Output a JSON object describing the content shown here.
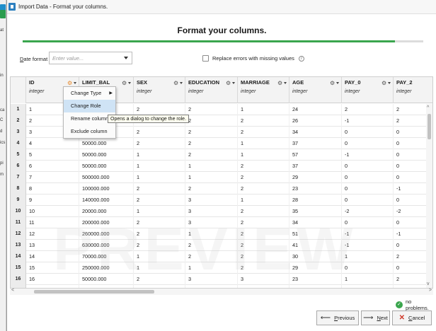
{
  "window": {
    "title": "Import Data - Format your columns."
  },
  "background_app": {
    "sidebar_fragments": [
      "at",
      "in",
      "ca",
      "C",
      "d",
      "ics",
      "pi",
      "m"
    ]
  },
  "page": {
    "heading": "Format your columns.",
    "progress_percent": 93
  },
  "date_format": {
    "label_prefix": "D",
    "label_rest": "ate format",
    "placeholder": "Enter value..."
  },
  "replace_errors": {
    "label": "Replace errors with missing values",
    "checked": false,
    "info_icon": "info-icon"
  },
  "columns": [
    {
      "name": "ID",
      "type": "integer"
    },
    {
      "name": "LIMIT_BAL",
      "type": "integer"
    },
    {
      "name": "SEX",
      "type": "integer"
    },
    {
      "name": "EDUCATION",
      "type": "integer"
    },
    {
      "name": "MARRIAGE",
      "type": "integer"
    },
    {
      "name": "AGE",
      "type": "integer"
    },
    {
      "name": "PAY_0",
      "type": "integer"
    },
    {
      "name": "PAY_2",
      "type": "integer"
    }
  ],
  "rows": [
    {
      "n": "1",
      "cells": [
        "1",
        "",
        "2",
        "2",
        "1",
        "24",
        "2",
        "2"
      ]
    },
    {
      "n": "2",
      "cells": [
        "2",
        "",
        "2",
        "2",
        "2",
        "26",
        "-1",
        "2"
      ]
    },
    {
      "n": "3",
      "cells": [
        "3",
        "",
        "2",
        "2",
        "2",
        "34",
        "0",
        "0"
      ]
    },
    {
      "n": "4",
      "cells": [
        "4",
        "50000.000",
        "2",
        "2",
        "1",
        "37",
        "0",
        "0"
      ]
    },
    {
      "n": "5",
      "cells": [
        "5",
        "50000.000",
        "1",
        "2",
        "1",
        "57",
        "-1",
        "0"
      ]
    },
    {
      "n": "6",
      "cells": [
        "6",
        "50000.000",
        "1",
        "1",
        "2",
        "37",
        "0",
        "0"
      ]
    },
    {
      "n": "7",
      "cells": [
        "7",
        "500000.000",
        "1",
        "1",
        "2",
        "29",
        "0",
        "0"
      ]
    },
    {
      "n": "8",
      "cells": [
        "8",
        "100000.000",
        "2",
        "2",
        "2",
        "23",
        "0",
        "-1"
      ]
    },
    {
      "n": "9",
      "cells": [
        "9",
        "140000.000",
        "2",
        "3",
        "1",
        "28",
        "0",
        "0"
      ]
    },
    {
      "n": "10",
      "cells": [
        "10",
        "20000.000",
        "1",
        "3",
        "2",
        "35",
        "-2",
        "-2"
      ]
    },
    {
      "n": "11",
      "cells": [
        "11",
        "200000.000",
        "2",
        "3",
        "2",
        "34",
        "0",
        "0"
      ]
    },
    {
      "n": "12",
      "cells": [
        "12",
        "260000.000",
        "2",
        "1",
        "2",
        "51",
        "-1",
        "-1"
      ]
    },
    {
      "n": "13",
      "cells": [
        "13",
        "630000.000",
        "2",
        "2",
        "2",
        "41",
        "-1",
        "0"
      ]
    },
    {
      "n": "14",
      "cells": [
        "14",
        "70000.000",
        "1",
        "2",
        "2",
        "30",
        "1",
        "2"
      ]
    },
    {
      "n": "15",
      "cells": [
        "15",
        "250000.000",
        "1",
        "1",
        "2",
        "29",
        "0",
        "0"
      ]
    },
    {
      "n": "16",
      "cells": [
        "16",
        "50000.000",
        "2",
        "3",
        "3",
        "23",
        "1",
        "2"
      ]
    },
    {
      "n": "17",
      "cells": [
        "17",
        "20000.000",
        "1",
        "1",
        "2",
        "24",
        "0",
        "0"
      ]
    }
  ],
  "context_menu": {
    "items": [
      {
        "label": "Change Type",
        "has_submenu": true
      },
      {
        "label": "Change Role",
        "active": true
      },
      {
        "label": "Rename column"
      },
      {
        "label": "Exclude column"
      }
    ],
    "tooltip": "Opens a dialog to change the role."
  },
  "watermark": "PREVIEW",
  "status": {
    "text": "no problems."
  },
  "buttons": {
    "previous": {
      "label_prefix": "",
      "underline": "P",
      "label_rest": "revious"
    },
    "next": {
      "underline": "N",
      "label_rest": "ext"
    },
    "cancel": {
      "underline": "C",
      "label_rest": "ancel"
    }
  },
  "colors": {
    "accent_green": "#3aa54d",
    "menu_highlight": "#cfe3f5",
    "gear_active": "#e8892b",
    "cancel_icon": "#d03a2a"
  }
}
